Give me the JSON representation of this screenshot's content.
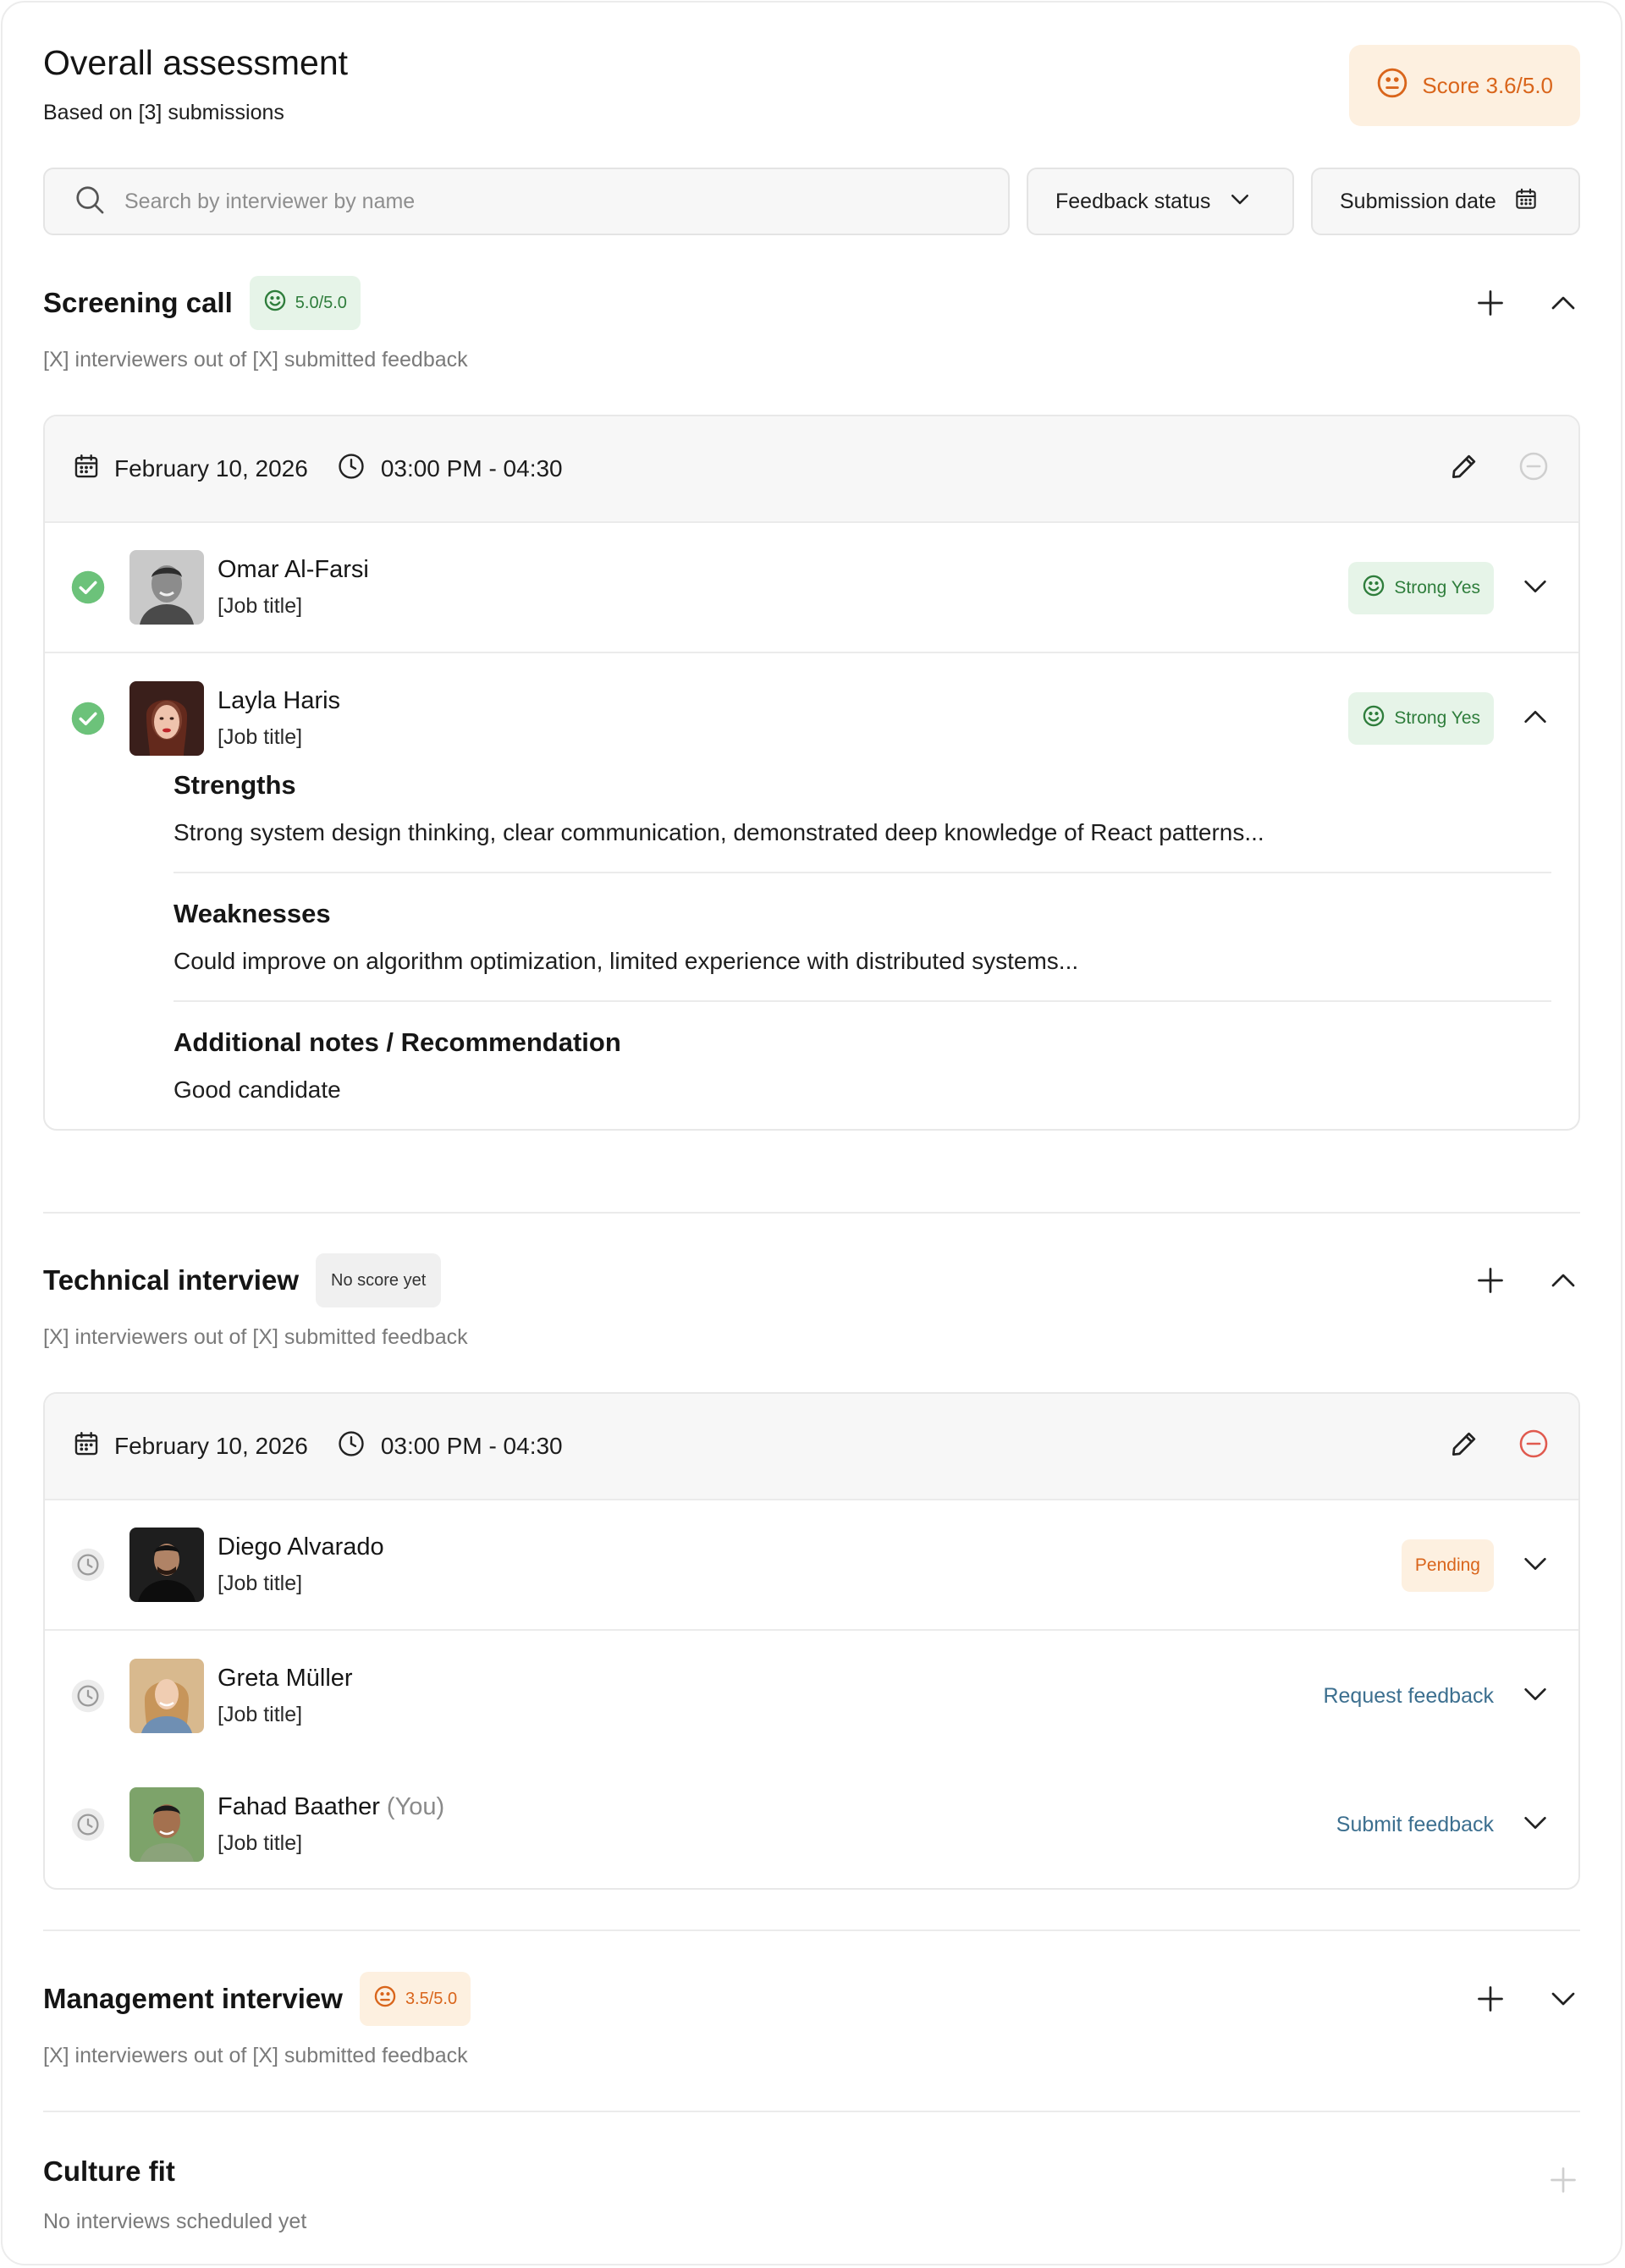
{
  "header": {
    "title": "Overall assessment",
    "subtitle": "Based on [3] submissions",
    "score_label": "Score 3.6/5.0"
  },
  "filters": {
    "search_placeholder": "Search by interviewer by name",
    "feedback_status_label": "Feedback status",
    "submission_date_label": "Submission date"
  },
  "colors": {
    "accent_orange": "#d9651b",
    "accent_green": "#2e7d3b",
    "link_blue": "#3c6f8f",
    "danger_red": "#e05a4f"
  },
  "screening": {
    "title": "Screening call",
    "score": "5.0/5.0",
    "subtitle": "[X] interviewers out of [X] submitted feedback",
    "date": "February 10, 2026",
    "time": "03:00 PM - 04:30",
    "interviewers": [
      {
        "name": "Omar Al-Farsi",
        "job": "[Job title]",
        "verdict": "Strong Yes"
      },
      {
        "name": "Layla Haris",
        "job": "[Job title]",
        "verdict": "Strong Yes"
      }
    ],
    "feedback": {
      "strengths_title": "Strengths",
      "strengths_text": "Strong system design thinking, clear communication, demonstrated deep knowledge of React patterns...",
      "weaknesses_title": "Weaknesses",
      "weaknesses_text": "Could improve on algorithm optimization, limited experience with distributed systems...",
      "notes_title": "Additional notes / Recommendation",
      "notes_text": "Good candidate"
    }
  },
  "technical": {
    "title": "Technical interview",
    "score": "No score yet",
    "subtitle": "[X] interviewers out of [X] submitted feedback",
    "date": "February 10, 2026",
    "time": "03:00 PM - 04:30",
    "interviewers": [
      {
        "name": "Diego Alvarado",
        "job": "[Job title]",
        "action": "Pending"
      },
      {
        "name": "Greta Müller",
        "job": "[Job title]",
        "action": "Request feedback"
      },
      {
        "name": "Fahad Baather",
        "you": "(You)",
        "job": "[Job title]",
        "action": "Submit feedback"
      }
    ]
  },
  "management": {
    "title": "Management interview",
    "score": "3.5/5.0",
    "subtitle": "[X] interviewers out of [X] submitted feedback"
  },
  "culture": {
    "title": "Culture fit",
    "subtitle": "No interviews scheduled yet"
  },
  "icons": {
    "smile": "smile-icon",
    "neutral": "neutral-face-icon",
    "search": "search-icon",
    "calendar": "calendar-icon",
    "clock": "clock-icon",
    "plus": "plus-icon",
    "chevron-up": "chevron-up-icon",
    "chevron-down": "chevron-down-icon",
    "pencil": "pencil-icon",
    "minus-circle": "minus-circle-icon",
    "check-circle": "check-circle-icon"
  }
}
